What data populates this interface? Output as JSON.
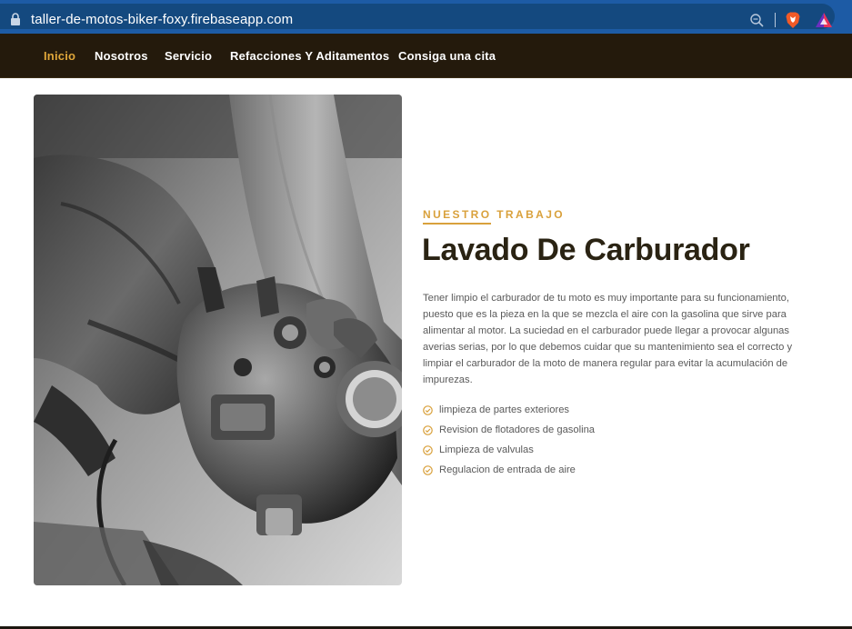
{
  "browser": {
    "url": "taller-de-motos-biker-foxy.firebaseapp.com",
    "icons": [
      "lock-icon",
      "zoom-icon",
      "brave-icon",
      "brave-rewards-icon"
    ]
  },
  "nav": {
    "items": [
      {
        "label": "Inicio",
        "active": true
      },
      {
        "label": "Nosotros",
        "active": false
      },
      {
        "label": "Servicio",
        "active": false
      },
      {
        "label": "Refacciones Y Aditamentos",
        "active": false
      },
      {
        "label": "Consiga una cita",
        "active": false
      }
    ]
  },
  "section": {
    "eyebrow": "NUESTRO TRABAJO",
    "title": "Lavado De Carburador",
    "description": "Tener limpio el carburador de tu moto es muy importante para su funcionamiento, puesto que es la pieza en la que se mezcla el aire con la gasolina que sirve para alimentar al motor. La suciedad en el carburador puede llegar a provocar algunas averias serias, por lo que debemos cuidar que su mantenimiento sea el correcto y limpiar el carburador de la moto de manera regular para evitar la acumulación de impurezas.",
    "features": [
      "limpieza de partes exteriores",
      "Revision de flotadores de gasolina",
      "Limpieza de valvulas",
      "Regulacion de entrada de aire"
    ]
  },
  "colors": {
    "accent": "#d9a13c",
    "nav_bg": "#241a0c",
    "title": "#2a2313",
    "browser_bar": "#1d5ba5"
  }
}
